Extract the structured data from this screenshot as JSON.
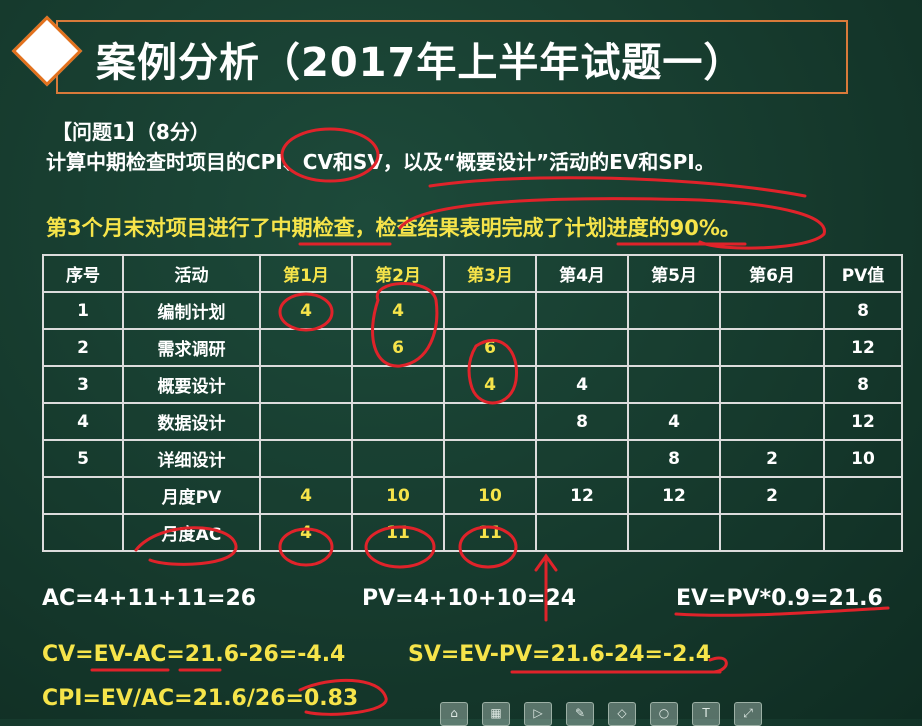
{
  "title": "案例分析（2017年上半年试题一）",
  "question": {
    "label": "【问题1】（8分）",
    "text": "计算中期检查时项目的CPI、CV和SV，以及“概要设计”活动的EV和SPI。",
    "hint": "第3个月末对项目进行了中期检查，检查结果表明完成了计划进度的90%。"
  },
  "table": {
    "headers": [
      "序号",
      "活动",
      "第1月",
      "第2月",
      "第3月",
      "第4月",
      "第5月",
      "第6月",
      "PV值"
    ],
    "rows": [
      [
        "1",
        "编制计划",
        "4",
        "4",
        "",
        "",
        "",
        "",
        "8"
      ],
      [
        "2",
        "需求调研",
        "",
        "6",
        "6",
        "",
        "",
        "",
        "12"
      ],
      [
        "3",
        "概要设计",
        "",
        "",
        "4",
        "4",
        "",
        "",
        "8"
      ],
      [
        "4",
        "数据设计",
        "",
        "",
        "",
        "8",
        "4",
        "",
        "12"
      ],
      [
        "5",
        "详细设计",
        "",
        "",
        "",
        "",
        "8",
        "2",
        "10"
      ],
      [
        "",
        "月度PV",
        "4",
        "10",
        "10",
        "12",
        "12",
        "2",
        ""
      ],
      [
        "",
        "月度AC",
        "4",
        "11",
        "11",
        "",
        "",
        "",
        ""
      ]
    ]
  },
  "equations": {
    "ac": "AC=4+11+11=26",
    "pv": "PV=4+10+10=24",
    "ev": "EV=PV*0.9=21.6",
    "cv": "CV=EV-AC=21.6-26=-4.4",
    "sv": "SV=EV-PV=21.6-24=-2.4",
    "cpi": "CPI=EV/AC=21.6/26=0.83"
  },
  "colors": {
    "background": "#163a2d",
    "accent_orange": "#e2711d",
    "highlight_yellow": "#f6e44a",
    "ink_red": "#e0232a"
  },
  "toolbar_icons": [
    "home-icon",
    "grid-icon",
    "play-icon",
    "pen-icon",
    "shape-icon",
    "circle-icon",
    "text-icon",
    "expand-icon"
  ]
}
